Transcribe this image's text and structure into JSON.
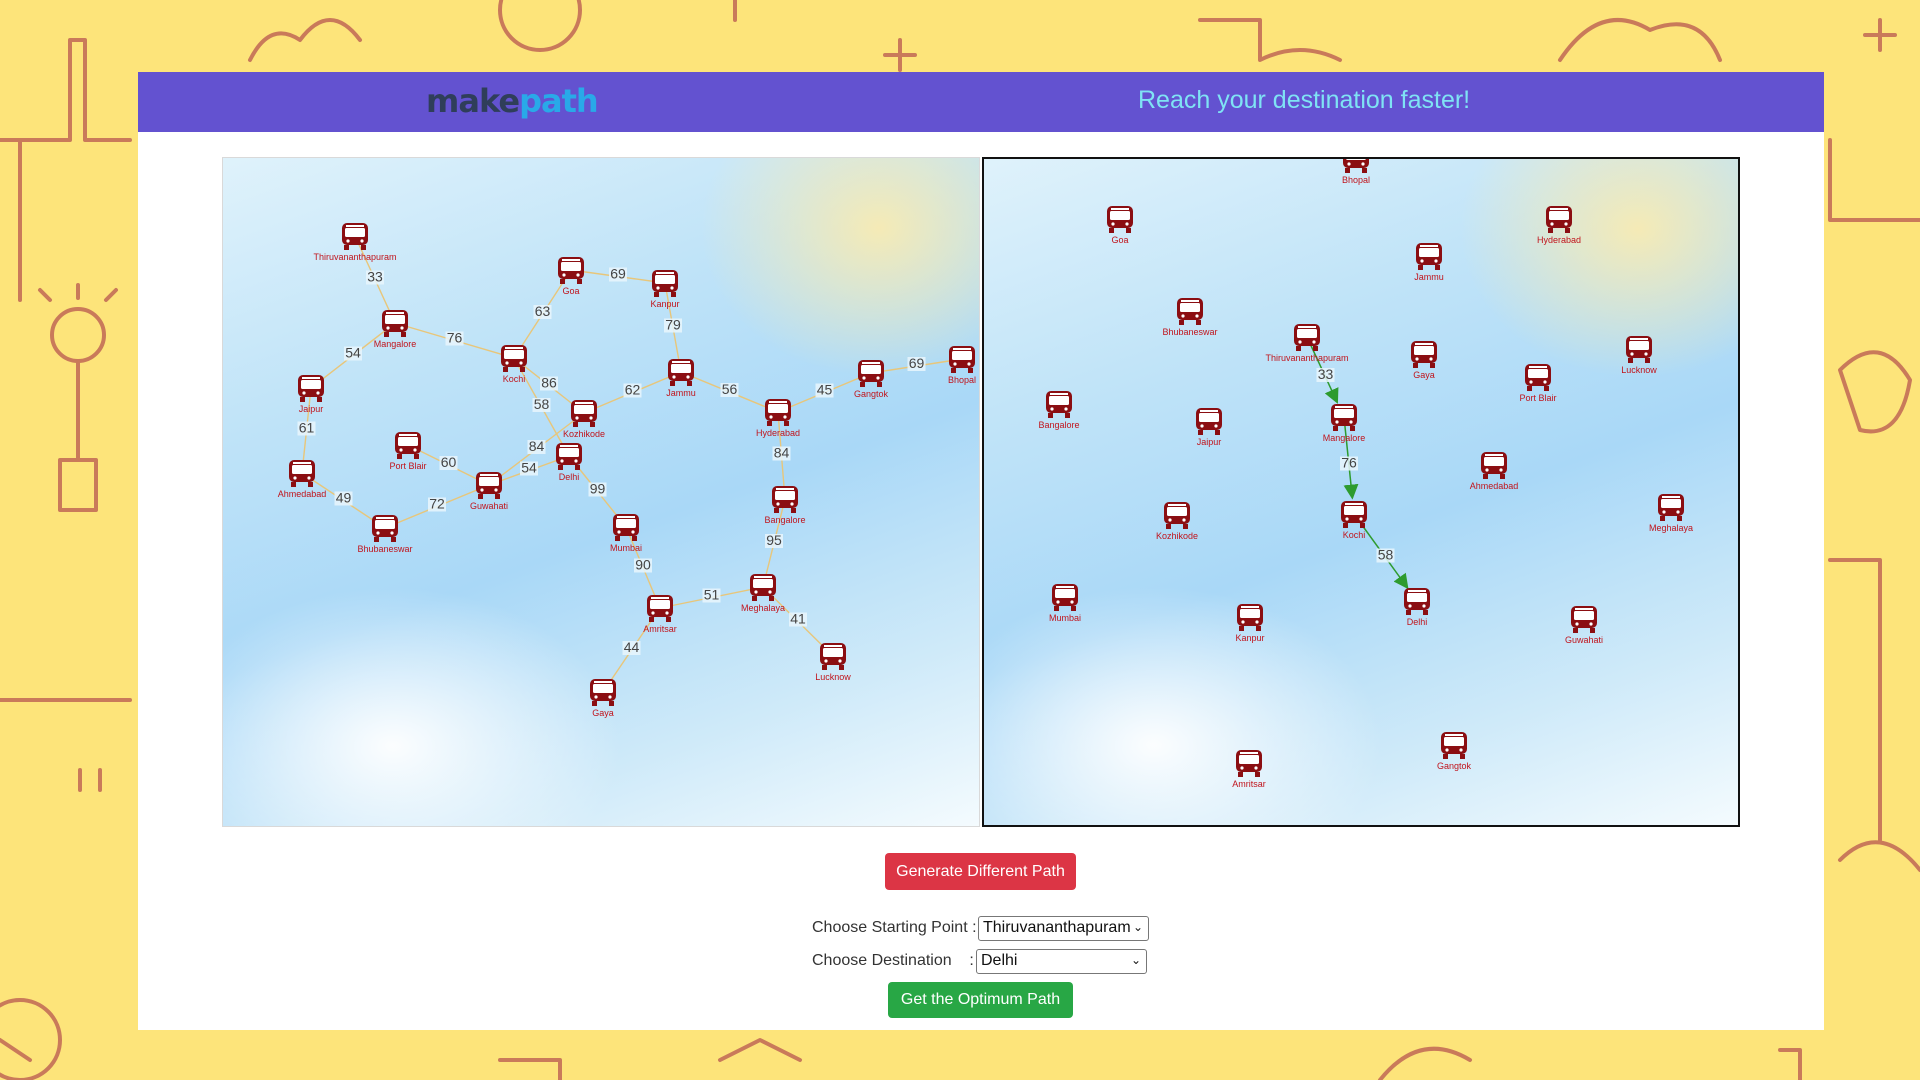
{
  "header": {
    "logo_make": "make",
    "logo_path": "path",
    "tagline": "Reach your destination faster!"
  },
  "controls": {
    "generate_label": "Generate Different Path",
    "start_label": "Choose Starting Point :",
    "start_value": "Thiruvananthapuram",
    "dest_label": "Choose Destination    :",
    "dest_value": "Delhi",
    "optimum_label": "Get the Optimum Path"
  },
  "colors": {
    "header_bg": "#6352d0",
    "bus": "#8b0e12",
    "label": "#c0141c",
    "edge": "#e8c67a",
    "path_edge": "#2e9b2e",
    "generate": "#dc3545",
    "optimum": "#28a745"
  },
  "icons": {
    "city_node": "bus-icon",
    "dropdown": "chevron-down-icon"
  },
  "graph": {
    "nodes": [
      {
        "id": "Thiruvananthapuram"
      },
      {
        "id": "Goa"
      },
      {
        "id": "Kanpur"
      },
      {
        "id": "Mangalore"
      },
      {
        "id": "Kochi"
      },
      {
        "id": "Jammu"
      },
      {
        "id": "Gangtok"
      },
      {
        "id": "Bhopal"
      },
      {
        "id": "Jaipur"
      },
      {
        "id": "Kozhikode"
      },
      {
        "id": "Hyderabad"
      },
      {
        "id": "Port Blair"
      },
      {
        "id": "Delhi"
      },
      {
        "id": "Ahmedabad"
      },
      {
        "id": "Guwahati"
      },
      {
        "id": "Bangalore"
      },
      {
        "id": "Mumbai"
      },
      {
        "id": "Bhubaneswar"
      },
      {
        "id": "Amritsar"
      },
      {
        "id": "Meghalaya"
      },
      {
        "id": "Lucknow"
      },
      {
        "id": "Gaya"
      }
    ],
    "edges": [
      {
        "from": "Thiruvananthapuram",
        "to": "Mangalore",
        "weight": "33"
      },
      {
        "from": "Goa",
        "to": "Kanpur",
        "weight": "69"
      },
      {
        "from": "Goa",
        "to": "Kochi",
        "weight": "63"
      },
      {
        "from": "Kanpur",
        "to": "Jammu",
        "weight": "79"
      },
      {
        "from": "Mangalore",
        "to": "Kochi",
        "weight": "76"
      },
      {
        "from": "Mangalore",
        "to": "Jaipur",
        "weight": "54"
      },
      {
        "from": "Kochi",
        "to": "Kozhikode",
        "weight": "86"
      },
      {
        "from": "Kochi",
        "to": "Delhi",
        "weight": "58"
      },
      {
        "from": "Kozhikode",
        "to": "Jammu",
        "weight": "62"
      },
      {
        "from": "Jammu",
        "to": "Hyderabad",
        "weight": "56"
      },
      {
        "from": "Hyderabad",
        "to": "Gangtok",
        "weight": "45"
      },
      {
        "from": "Gangtok",
        "to": "Bhopal",
        "weight": "69"
      },
      {
        "from": "Jaipur",
        "to": "Ahmedabad",
        "weight": "61"
      },
      {
        "from": "Ahmedabad",
        "to": "Bhubaneswar",
        "weight": "49"
      },
      {
        "from": "Bhubaneswar",
        "to": "Guwahati",
        "weight": "72"
      },
      {
        "from": "Port Blair",
        "to": "Guwahati",
        "weight": "60"
      },
      {
        "from": "Guwahati",
        "to": "Kozhikode",
        "weight": "84"
      },
      {
        "from": "Guwahati",
        "to": "Delhi",
        "weight": "54"
      },
      {
        "from": "Delhi",
        "to": "Mumbai",
        "weight": "99"
      },
      {
        "from": "Mumbai",
        "to": "Amritsar",
        "weight": "90"
      },
      {
        "from": "Amritsar",
        "to": "Meghalaya",
        "weight": "51"
      },
      {
        "from": "Amritsar",
        "to": "Gaya",
        "weight": "44"
      },
      {
        "from": "Meghalaya",
        "to": "Bangalore",
        "weight": "95"
      },
      {
        "from": "Meghalaya",
        "to": "Lucknow",
        "weight": "41"
      },
      {
        "from": "Bangalore",
        "to": "Hyderabad",
        "weight": "84"
      }
    ],
    "path_nodes": [
      {
        "id": "Bhopal"
      },
      {
        "id": "Goa"
      },
      {
        "id": "Hyderabad"
      },
      {
        "id": "Jammu"
      },
      {
        "id": "Bhubaneswar"
      },
      {
        "id": "Thiruvananthapuram"
      },
      {
        "id": "Gaya"
      },
      {
        "id": "Lucknow"
      },
      {
        "id": "Port Blair"
      },
      {
        "id": "Bangalore"
      },
      {
        "id": "Jaipur"
      },
      {
        "id": "Mangalore"
      },
      {
        "id": "Ahmedabad"
      },
      {
        "id": "Meghalaya"
      },
      {
        "id": "Kochi"
      },
      {
        "id": "Kozhikode"
      },
      {
        "id": "Delhi"
      },
      {
        "id": "Mumbai"
      },
      {
        "id": "Kanpur"
      },
      {
        "id": "Guwahati"
      },
      {
        "id": "Gangtok"
      },
      {
        "id": "Amritsar"
      }
    ],
    "path_edges": [
      {
        "from": "Thiruvananthapuram",
        "to": "Mangalore",
        "weight": "33"
      },
      {
        "from": "Mangalore",
        "to": "Kochi",
        "weight": "76"
      },
      {
        "from": "Kochi",
        "to": "Delhi",
        "weight": "58"
      }
    ]
  }
}
